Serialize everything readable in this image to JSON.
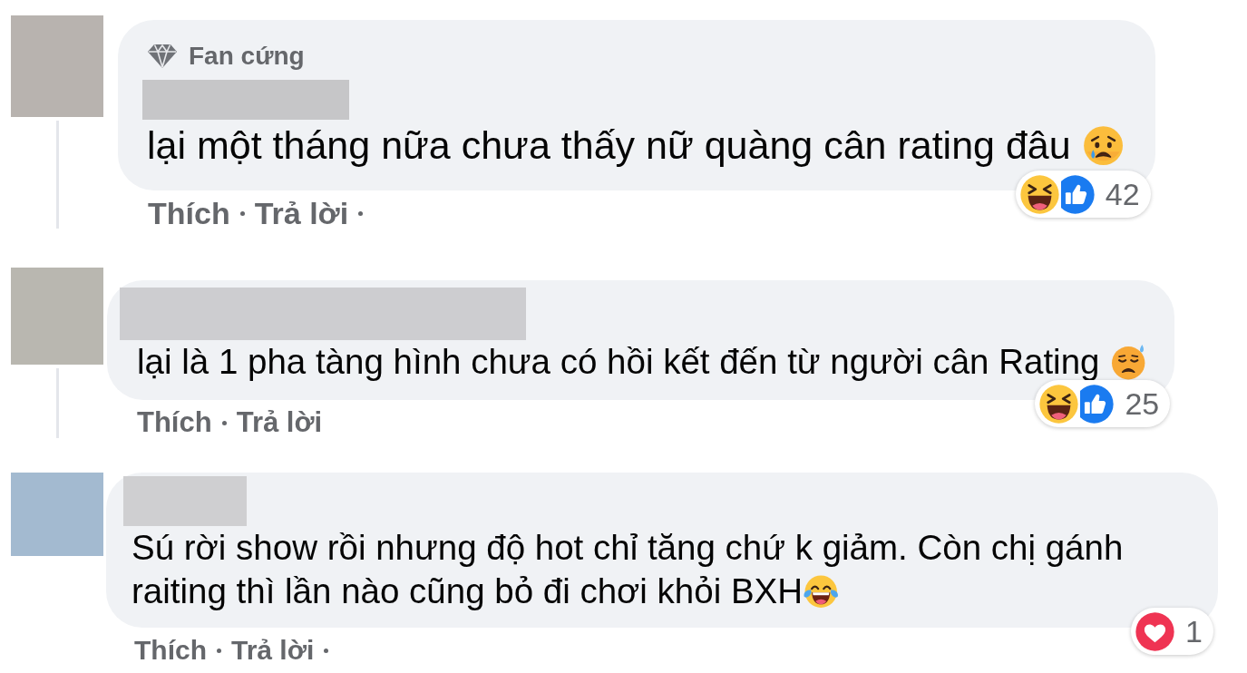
{
  "comments": [
    {
      "badge": "Fan cứng",
      "lines": [
        "lại một tháng nữa chưa thấy nữ quàng cân rating đâu"
      ],
      "emoji": {
        "kind": "sad_tear",
        "after_space": true
      },
      "reactions": {
        "types": [
          {
            "kind": "haha"
          },
          {
            "kind": "like"
          }
        ],
        "count": "42"
      },
      "actions": [
        "Thích",
        "Trả lời"
      ],
      "trailing_dot": true,
      "thread_line": true
    },
    {
      "lines": [
        "lại là 1 pha tàng hình chưa có hồi kết đến từ người cân Rating"
      ],
      "emoji": {
        "kind": "downcast_sweat",
        "after_space": true
      },
      "reactions": {
        "types": [
          {
            "kind": "haha"
          },
          {
            "kind": "like"
          }
        ],
        "count": "25"
      },
      "actions": [
        "Thích",
        "Trả lời"
      ],
      "trailing_dot": false,
      "thread_line": true
    },
    {
      "lines": [
        "Sú rời show rồi nhưng độ hot chỉ tăng chứ k giảm. Còn chị gánh",
        "raiting thì lần nào cũng bỏ đi chơi khỏi BXH"
      ],
      "emoji": {
        "kind": "tears_of_joy",
        "after_space": false
      },
      "reactions": {
        "types": [
          {
            "kind": "love"
          }
        ],
        "count": "1"
      },
      "actions": [
        "Thích",
        "Trả lời"
      ],
      "trailing_dot": true,
      "thread_line": false
    }
  ]
}
